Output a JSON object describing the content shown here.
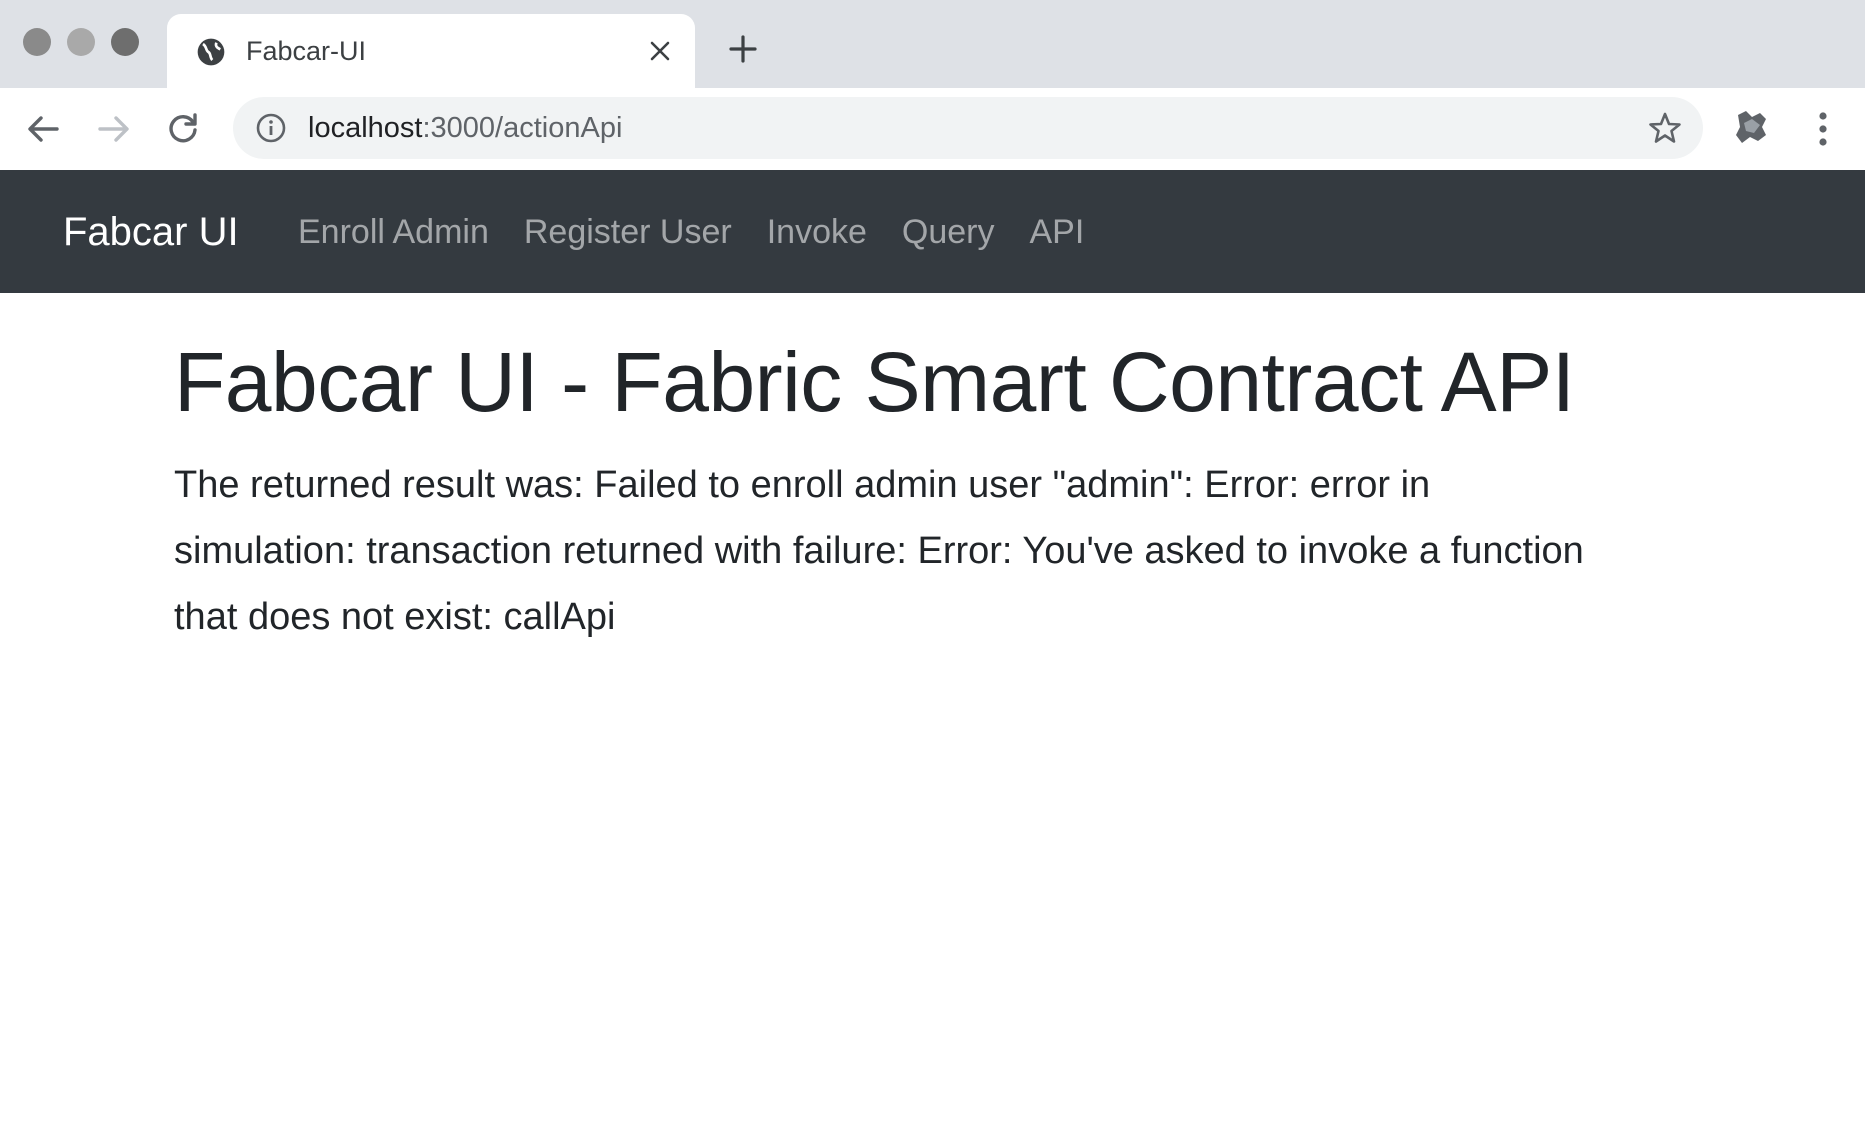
{
  "browser": {
    "tab": {
      "title": "Fabcar-UI"
    },
    "address_bar": {
      "host": "localhost",
      "path": ":3000/actionApi"
    }
  },
  "navbar": {
    "brand": "Fabcar UI",
    "links": [
      {
        "label": "Enroll Admin"
      },
      {
        "label": "Register User"
      },
      {
        "label": "Invoke"
      },
      {
        "label": "Query"
      },
      {
        "label": "API"
      }
    ]
  },
  "main": {
    "title": "Fabcar UI - Fabric Smart Contract API",
    "result_text": "The returned result was: Failed to enroll admin user \"admin\": Error: error in simulation: transaction returned with failure: Error: You've asked to invoke a function that does not exist: callApi"
  },
  "colors": {
    "navbar_bg": "#343a40",
    "tabstrip_bg": "#dee1e6",
    "text": "#212529"
  },
  "icons": [
    "globe-icon",
    "close-icon",
    "plus-icon",
    "back-arrow-icon",
    "forward-arrow-icon",
    "reload-icon",
    "info-icon",
    "star-icon",
    "extension-icon",
    "more-vert-icon"
  ]
}
